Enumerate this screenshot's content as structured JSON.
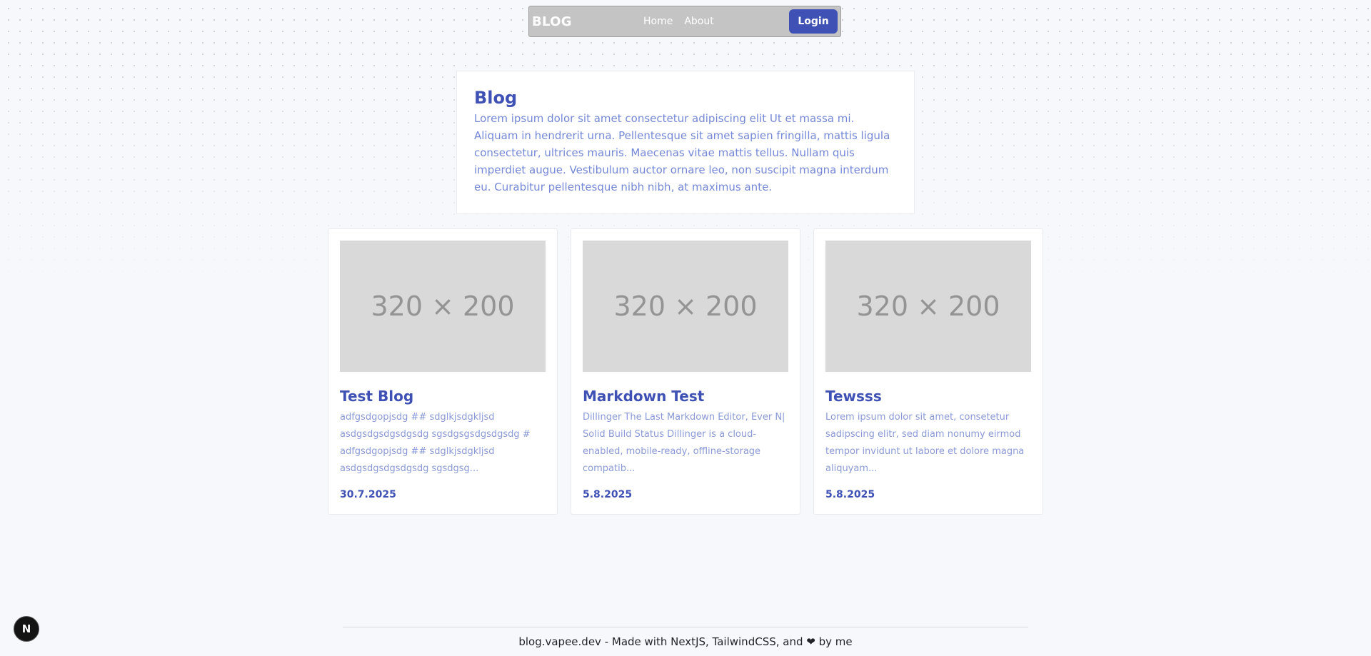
{
  "navbar": {
    "brand": "BLOG",
    "links": [
      "Home",
      "About"
    ],
    "login_label": "Login"
  },
  "intro": {
    "title": "Blog",
    "text": "Lorem ipsum dolor sit amet consectetur adipiscing elit Ut et massa mi. Aliquam in hendrerit urna. Pellentesque sit amet sapien fringilla, mattis ligula consectetur, ultrices mauris. Maecenas vitae mattis tellus. Nullam quis imperdiet augue. Vestibulum auctor ornare leo, non suscipit magna interdum eu. Curabitur pellentesque nibh nibh, at maximus ante."
  },
  "posts": [
    {
      "thumb_label": "320 × 200",
      "title": "Test Blog",
      "excerpt": "adfgsdgopjsdg ## sdglkjsdgkljsd asdgsdgsdgsdgsdg sgsdgsgsdgsdgsdg # adfgsdgopjsdg ## sdglkjsdgkljsd asdgsdgsdgsdgsdg sgsdgsg...",
      "date": "30.7.2025"
    },
    {
      "thumb_label": "320 × 200",
      "title": "Markdown Test",
      "excerpt": "Dillinger The Last Markdown Editor, Ever N| Solid Build Status Dillinger is a cloud-enabled, mobile-ready, offline-storage compatib...",
      "date": "5.8.2025"
    },
    {
      "thumb_label": "320 × 200",
      "title": "Tewsss",
      "excerpt": "Lorem ipsum dolor sit amet, consetetur sadipscing elitr, sed diam nonumy eirmod tempor invidunt ut labore et dolore magna aliquyam...",
      "date": "5.8.2025"
    }
  ],
  "footer": {
    "text_before": "blog.vapee.dev - Made with NextJS, TailwindCSS, and",
    "heart": "❤",
    "text_after": "by me"
  },
  "next_badge": {
    "label": "N"
  },
  "colors": {
    "accent": "#3f51b5",
    "accent_light": "#7588d8",
    "navbar_bg": "#c4c4c4"
  },
  "icons": {
    "footer_heart": "heart-icon"
  }
}
